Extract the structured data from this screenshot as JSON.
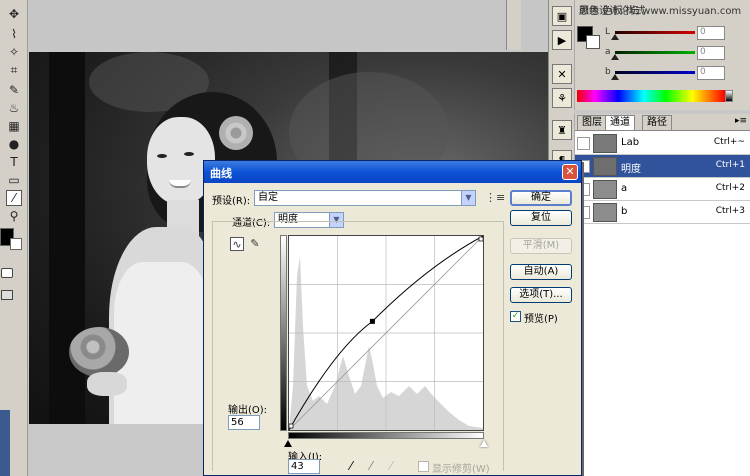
{
  "watermark": "思缘设计论坛 www.missyuan.com",
  "color_panel": {
    "tab_label": "颜色  色板  样式",
    "sliders": [
      {
        "label": "L",
        "value": "0",
        "color": "#d40000",
        "level": 0
      },
      {
        "label": "a",
        "value": "0",
        "color": "#00b000",
        "level": 0
      },
      {
        "label": "b",
        "value": "0",
        "color": "#0000c8",
        "level": 0
      }
    ]
  },
  "channels_panel": {
    "tabs": [
      "图层",
      "通道",
      "路径"
    ],
    "active_tab": 1,
    "channels": [
      {
        "name": "Lab",
        "shortcut": "Ctrl+~",
        "selected": false
      },
      {
        "name": "明度",
        "shortcut": "Ctrl+1",
        "selected": true
      },
      {
        "name": "a",
        "shortcut": "Ctrl+2",
        "selected": false
      },
      {
        "name": "b",
        "shortcut": "Ctrl+3",
        "selected": false
      }
    ]
  },
  "curves_dialog": {
    "title": "曲线",
    "close_label": "✕",
    "preset_label": "预设(R):",
    "preset_value": "自定",
    "channel_label": "通道(C):",
    "channel_value": "明度",
    "output_label": "输出(O):",
    "output_value": "56",
    "input_label": "输入(I):",
    "input_value": "43",
    "show_clipping_label": "显示修剪(W)",
    "show_clipping_checked": false,
    "preview_label": "预览(P)",
    "preview_checked": true,
    "buttons": {
      "ok": "确定",
      "reset": "复位",
      "smooth": "平滑(M)",
      "auto": "自动(A)",
      "options": "选项(T)..."
    },
    "curve_point": {
      "input": 43,
      "output": 56
    }
  },
  "colors": {
    "title_bar": "#0c52d6",
    "selection": "#31539c",
    "dialog_bg": "#ece9d8"
  },
  "icons": {
    "menu": "menu-icon",
    "curve_tool": "curve-icon",
    "pencil_tool": "pencil-icon"
  }
}
